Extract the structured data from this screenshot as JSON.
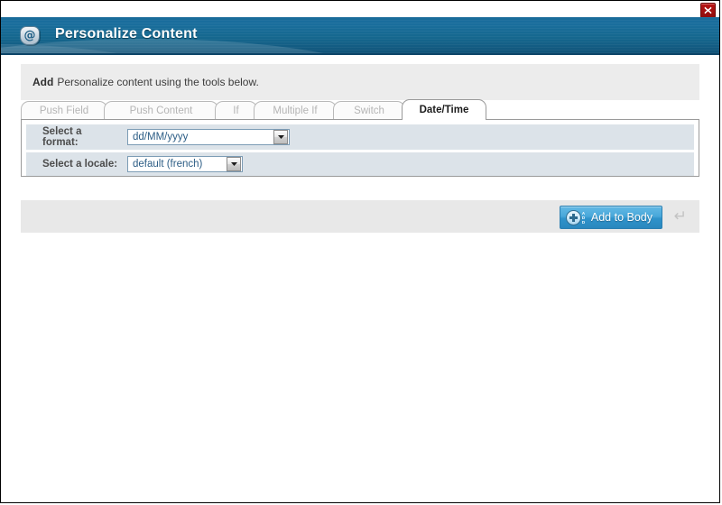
{
  "window": {
    "title": "Personalize Content",
    "app_icon": "at-email-icon",
    "close_label": "X"
  },
  "notice": {
    "bold": "Add",
    "text": "Personalize content using the tools below."
  },
  "tabs": [
    {
      "label": "Push Field",
      "active": false,
      "name": "tab-push-field"
    },
    {
      "label": "Push Content",
      "active": false,
      "name": "tab-push-content"
    },
    {
      "label": "If",
      "active": false,
      "name": "tab-if"
    },
    {
      "label": "Multiple If",
      "active": false,
      "name": "tab-multiple-if"
    },
    {
      "label": "Switch",
      "active": false,
      "name": "tab-switch"
    },
    {
      "label": "Date/Time",
      "active": true,
      "name": "tab-date-time"
    }
  ],
  "form": {
    "rows": [
      {
        "label": "Select a format:",
        "label_line1": "Select a",
        "label_line2": "format:",
        "value": "dd/MM/yyyy",
        "options": [
          "dd/MM/yyyy"
        ]
      },
      {
        "label": "Select a locale:",
        "label_line1": "Select a locale:",
        "label_line2": "",
        "value": "default (french)",
        "options": [
          "default (french)"
        ]
      }
    ]
  },
  "actions": {
    "add_to_body": "Add to Body",
    "add_icon_word": "ADD",
    "enter_hint": "↵"
  },
  "colors": {
    "header_blue": "#15688f",
    "accent_button": "#2f93cb",
    "row_bg": "#dce3e9",
    "notice_bg": "#ececec",
    "actionbar_bg": "#e8e8e8",
    "close_red": "#8d0c0c"
  }
}
